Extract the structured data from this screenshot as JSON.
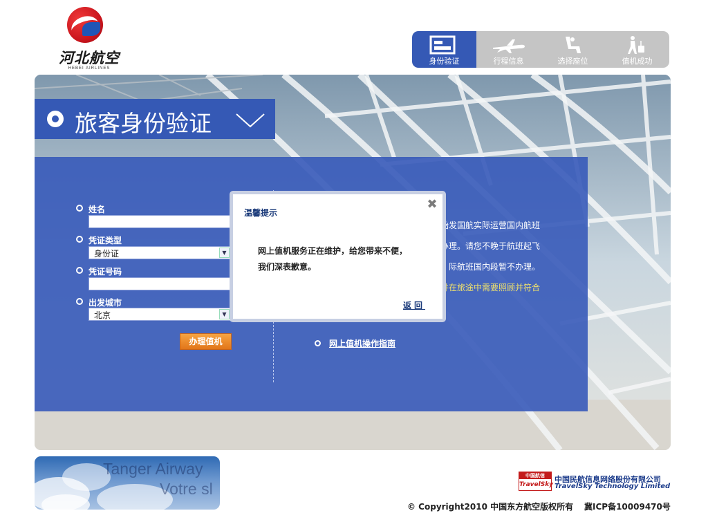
{
  "header": {
    "logo_cn": "河北航空",
    "logo_en": "HEBEI AIRLINES",
    "steps": [
      {
        "label": "身份验证",
        "icon": "id-card-icon",
        "active": true
      },
      {
        "label": "行程信息",
        "icon": "airplane-icon",
        "active": false
      },
      {
        "label": "选择座位",
        "icon": "seat-icon",
        "active": false
      },
      {
        "label": "值机成功",
        "icon": "traveler-icon",
        "active": false
      }
    ]
  },
  "page_title": "旅客身份验证",
  "form": {
    "name_label": "姓名",
    "name_value": "",
    "id_type_label": "凭证类型",
    "id_type_value": "身份证",
    "id_number_label": "凭证号码",
    "id_number_value": "",
    "city_label": "出发城市",
    "city_value": "北京",
    "submit_label": "办理值机"
  },
  "info": {
    "line1": "始发国航实际运营国内航班",
    "line2": "办理。请您不晚于航班起飞",
    "line3": "际航班国内段暂不办理。",
    "line4": "并在旅途中需要照顾并符合",
    "guide_link": "网上值机操作指南"
  },
  "dialog": {
    "title": "温馨提示",
    "close": "✖",
    "message_line1": "网上值机服务正在维护，给您带来不便，",
    "message_line2": "我们深表歉意。",
    "back_label": "返回"
  },
  "footer": {
    "banner_line1": "Tanger Airway",
    "banner_line2": "Votre sl",
    "travelsky_logo_top": "中国航信",
    "travelsky_logo_bottom": "TravelSky",
    "travelsky_cn": "中国民航信息网络股份有限公司",
    "travelsky_en": "TravelSky Technology Limited",
    "copyright": "© Copyright2010 中国东方航空版权所有",
    "icp": "冀ICP备10009470号"
  },
  "colors": {
    "brand_blue": "#3559b5",
    "button_orange": "#e2761a",
    "step_bar_grey": "#c5c5c5"
  }
}
